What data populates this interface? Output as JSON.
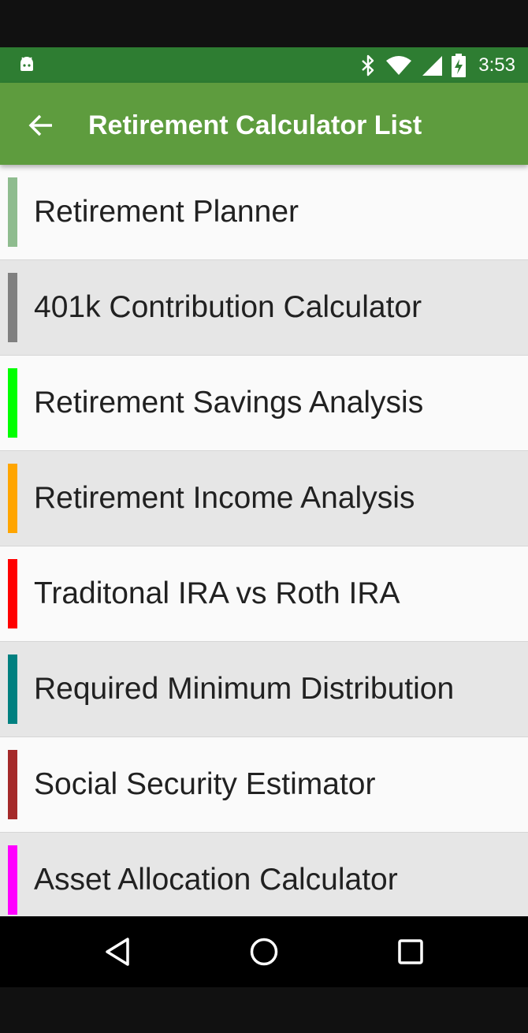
{
  "status_bar": {
    "time": "3:53",
    "icons": [
      "android-icon",
      "bluetooth-icon",
      "wifi-icon",
      "cell-signal-icon",
      "battery-charging-icon"
    ],
    "color": "#2e7d32"
  },
  "app_bar": {
    "title": "Retirement Calculator List",
    "back_icon": "arrow-back-icon",
    "color": "#5e9c3e"
  },
  "list": {
    "items": [
      {
        "label": "Retirement Planner",
        "color": "#8fbc8f"
      },
      {
        "label": "401k Contribution Calculator",
        "color": "#808080"
      },
      {
        "label": "Retirement Savings Analysis",
        "color": "#00ff00"
      },
      {
        "label": "Retirement Income Analysis",
        "color": "#ffa500"
      },
      {
        "label": "Traditonal IRA vs Roth IRA",
        "color": "#ff0000"
      },
      {
        "label": "Required Minimum Distribution",
        "color": "#008080"
      },
      {
        "label": "Social Security Estimator",
        "color": "#a52a2a"
      },
      {
        "label": "Asset Allocation Calculator",
        "color": "#ff00ff"
      }
    ]
  },
  "nav_bar": {
    "buttons": [
      "back-triangle-icon",
      "home-circle-icon",
      "recents-square-icon"
    ]
  }
}
